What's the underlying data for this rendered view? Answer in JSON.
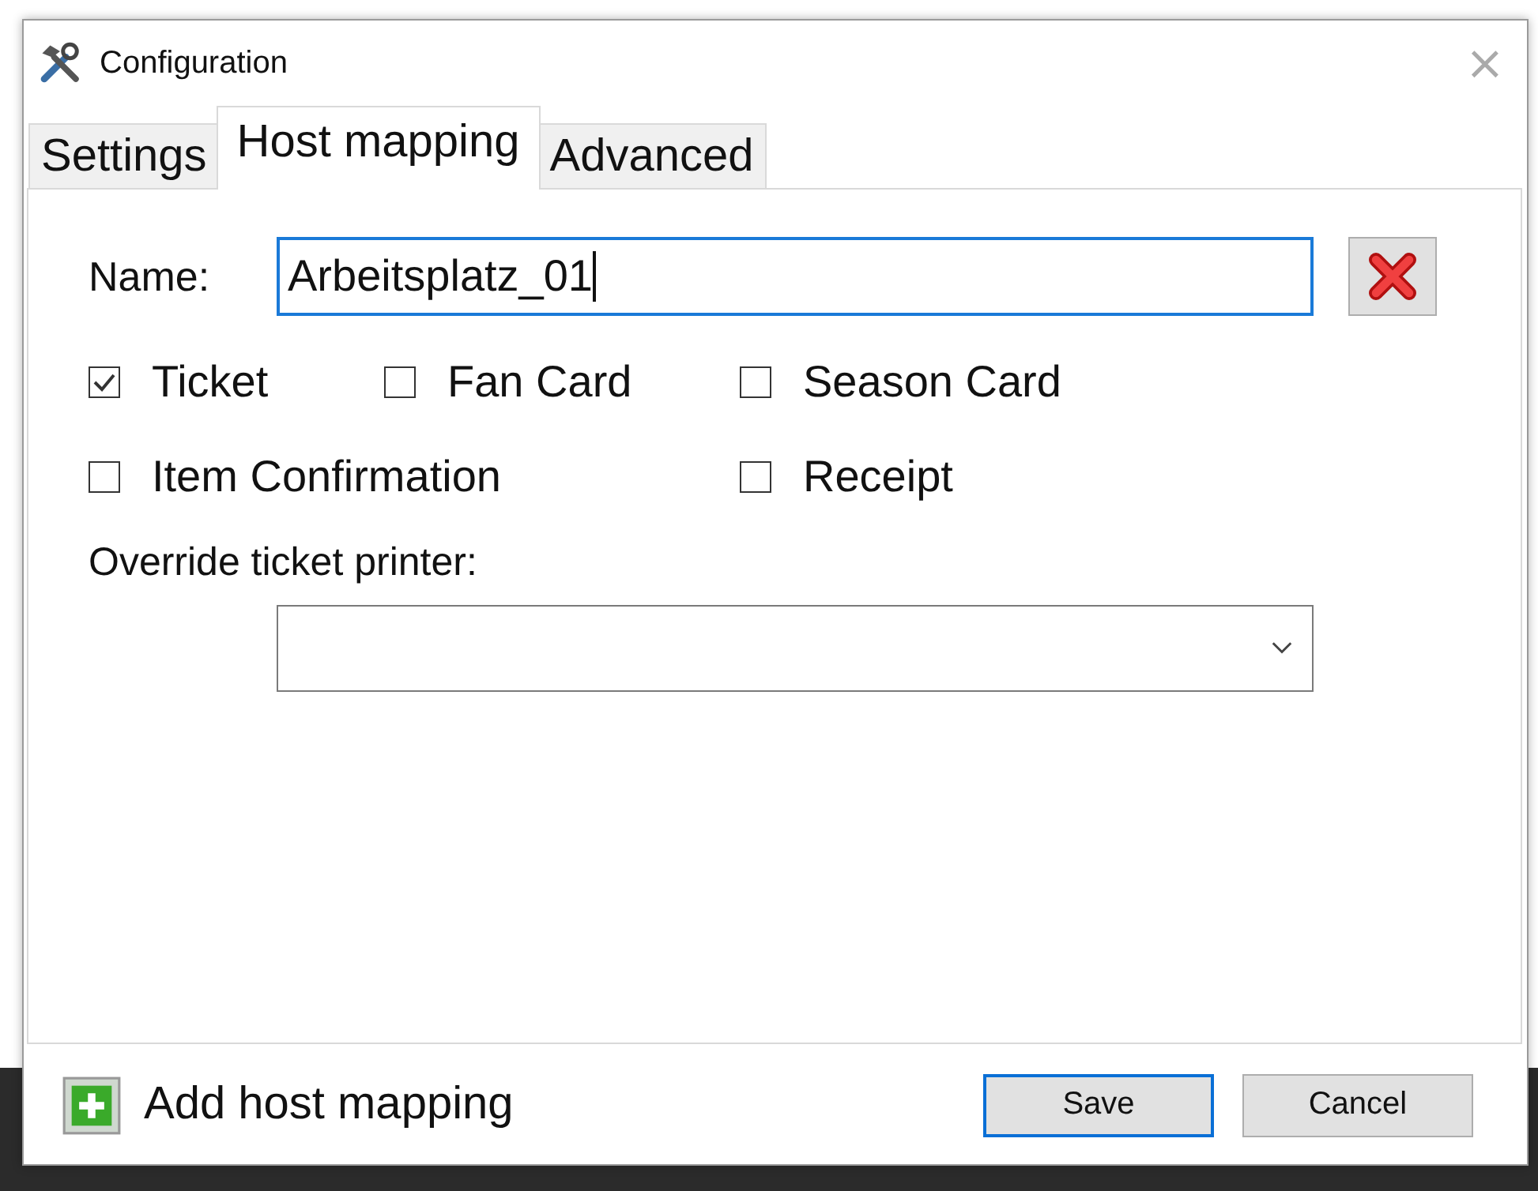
{
  "window": {
    "title": "Configuration",
    "close": "×"
  },
  "tabs": [
    {
      "label": "Settings",
      "selected": false
    },
    {
      "label": "Host mapping",
      "selected": true
    },
    {
      "label": "Advanced",
      "selected": false
    }
  ],
  "name_field": {
    "label": "Name:",
    "value": "Arbeitsplatz_01"
  },
  "checkbox_rows": [
    [
      {
        "label": "Ticket",
        "checked": true
      },
      {
        "label": "Fan Card",
        "checked": false
      },
      {
        "label": "Season Card",
        "checked": false
      }
    ],
    [
      {
        "label": "Item Confirmation",
        "checked": false
      },
      {
        "label": "Receipt",
        "checked": false
      }
    ]
  ],
  "printer": {
    "label": "Override ticket printer:"
  },
  "footer": {
    "add_label": "Add host mapping",
    "buttons": [
      {
        "label": "Save",
        "default": true
      },
      {
        "label": "Cancel",
        "default": false
      }
    ]
  }
}
